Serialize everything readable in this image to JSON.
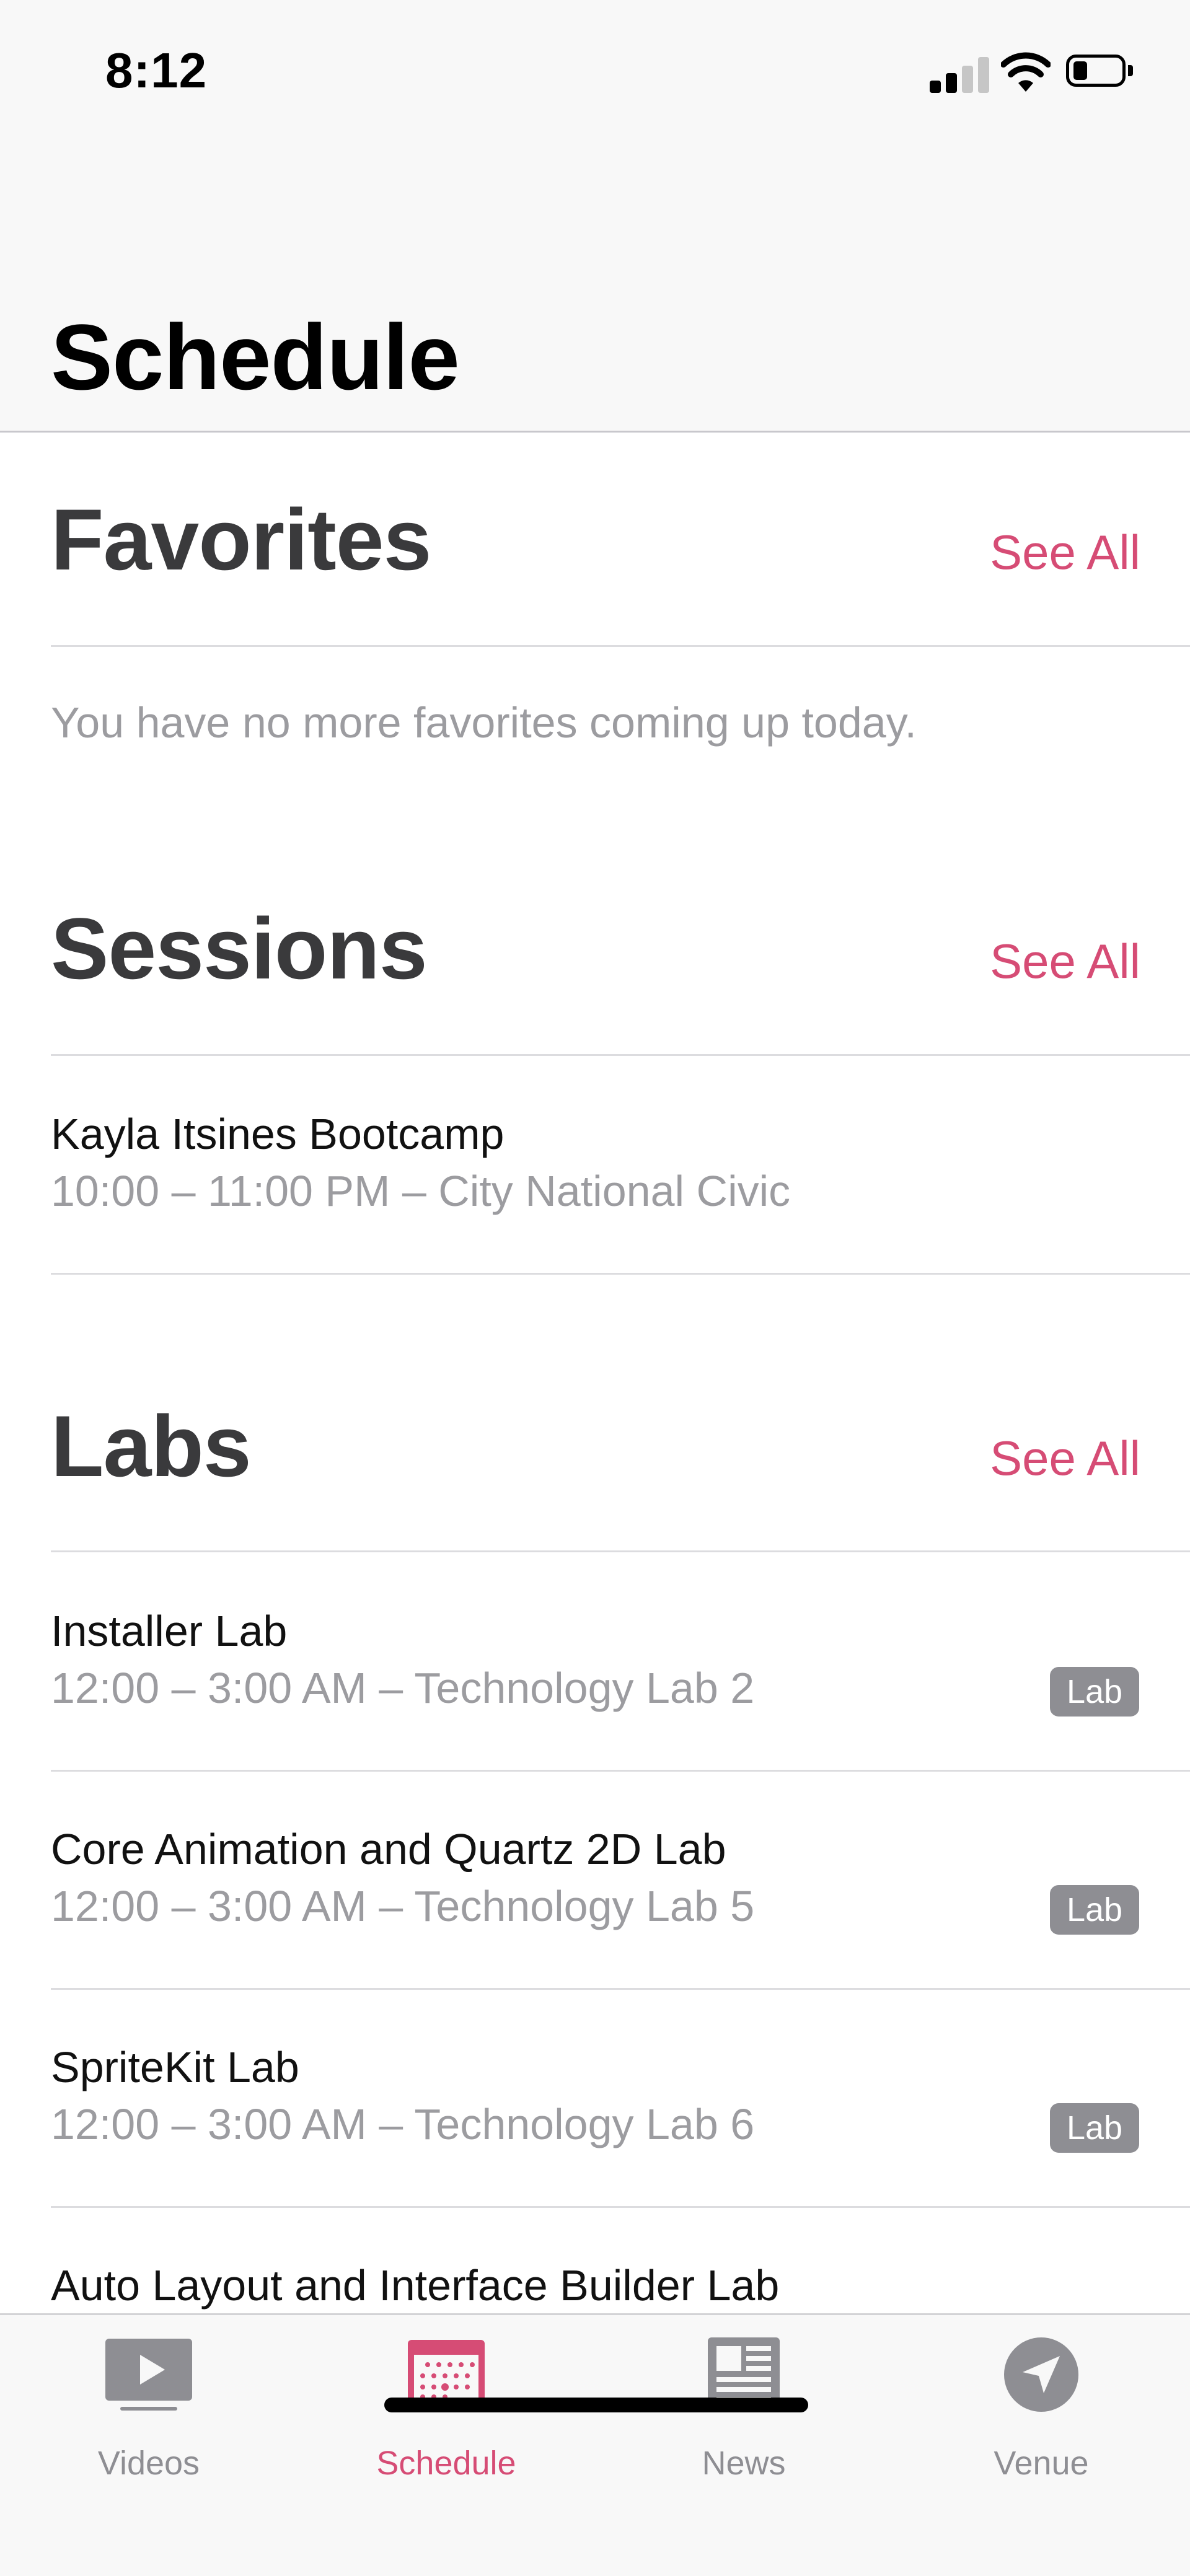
{
  "status_bar": {
    "time": "8:12"
  },
  "navigation": {
    "title": "Schedule"
  },
  "favorites": {
    "title": "Favorites",
    "see_all": "See All",
    "empty_message": "You have no more favorites coming up today."
  },
  "sessions": {
    "title": "Sessions",
    "see_all": "See All",
    "items": [
      {
        "title": "Kayla Itsines Bootcamp",
        "subtitle": "10:00 – 11:00 PM – City National Civic"
      }
    ]
  },
  "labs": {
    "title": "Labs",
    "see_all": "See All",
    "items": [
      {
        "title": "Installer Lab",
        "subtitle": "12:00 – 3:00 AM – Technology Lab 2",
        "badge": "Lab"
      },
      {
        "title": "Core Animation and Quartz 2D Lab",
        "subtitle": "12:00 – 3:00 AM – Technology Lab 5",
        "badge": "Lab"
      },
      {
        "title": "SpriteKit Lab",
        "subtitle": "12:00 – 3:00 AM – Technology Lab 6",
        "badge": "Lab"
      },
      {
        "title": "Auto Layout and Interface Builder Lab"
      }
    ]
  },
  "tab_bar": {
    "tabs": [
      {
        "label": "Videos",
        "icon": "play-video-icon"
      },
      {
        "label": "Schedule",
        "icon": "calendar-icon",
        "active": true
      },
      {
        "label": "News",
        "icon": "newspaper-icon"
      },
      {
        "label": "Venue",
        "icon": "location-arrow-icon"
      }
    ]
  },
  "colors": {
    "accent": "#d64c75",
    "secondary_text": "#9c9ca0",
    "badge": "#8e8e93"
  }
}
